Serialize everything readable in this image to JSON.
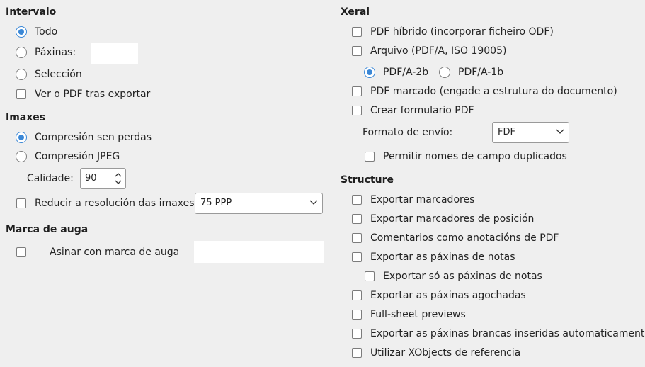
{
  "intervalo": {
    "title": "Intervalo",
    "todo": "Todo",
    "paxinas": "Páxinas:",
    "paxinas_value": "",
    "seleccion": "Selección",
    "ver_pdf": "Ver o PDF tras exportar"
  },
  "imaxes": {
    "title": "Imaxes",
    "compresion_sen_perdas": "Compresión sen perdas",
    "compresion_jpeg": "Compresión JPEG",
    "calidade_label": "Calidade:",
    "calidade_value": "90",
    "reducir_label": "Reducir a resolución das imaxes",
    "reducir_value": "75 PPP"
  },
  "marca": {
    "title": "Marca de auga",
    "asinar": "Asinar con marca de auga",
    "asinar_value": ""
  },
  "xeral": {
    "title": "Xeral",
    "pdf_hibrido": "PDF híbrido (incorporar ficheiro ODF)",
    "arquivo": "Arquivo (PDF/A, ISO 19005)",
    "pdfa2b": "PDF/A-2b",
    "pdfa1b": "PDF/A-1b",
    "pdf_marcado": "PDF marcado (engade a estrutura do documento)",
    "crear_formulario": "Crear formulario PDF",
    "formato_label": "Formato de envío:",
    "formato_value": "FDF",
    "permitir_nomes": "Permitir nomes de campo duplicados"
  },
  "structure": {
    "title": "Structure",
    "items": [
      "Exportar marcadores",
      "Exportar marcadores de posición",
      "Comentarios como anotacións de PDF",
      "Exportar as páxinas de notas",
      "Exportar só as páxinas de notas",
      "Exportar as páxinas agochadas",
      "Full-sheet previews",
      "Exportar as páxinas brancas inseridas automaticamente",
      "Utilizar XObjects de referencia"
    ]
  },
  "colors": {
    "accent": "#3a87d6",
    "background": "#efefef"
  }
}
